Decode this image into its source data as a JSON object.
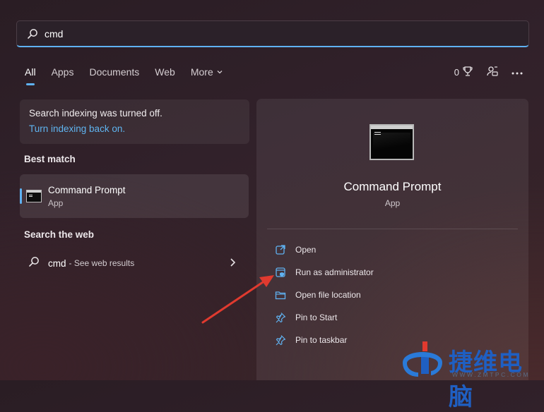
{
  "search": {
    "value": "cmd"
  },
  "tabs": [
    "All",
    "Apps",
    "Documents",
    "Web",
    "More"
  ],
  "toolbar": {
    "points": "0"
  },
  "indexing": {
    "message": "Search indexing was turned off.",
    "link": "Turn indexing back on."
  },
  "best_match": {
    "heading": "Best match",
    "item": {
      "title": "Command Prompt",
      "subtitle": "App"
    }
  },
  "web": {
    "heading": "Search the web",
    "query": "cmd",
    "hint": "- See web results"
  },
  "detail": {
    "title": "Command Prompt",
    "subtitle": "App",
    "actions": [
      {
        "label": "Open",
        "icon": "open-icon"
      },
      {
        "label": "Run as administrator",
        "icon": "shield-icon"
      },
      {
        "label": "Open file location",
        "icon": "folder-icon"
      },
      {
        "label": "Pin to Start",
        "icon": "pin-icon"
      },
      {
        "label": "Pin to taskbar",
        "icon": "pin-icon"
      }
    ]
  },
  "watermark": {
    "text": "捷维电脑",
    "sub": "WWW.ZMTPC.COM"
  },
  "colors": {
    "accent": "#5fb2f2",
    "link": "#5fb4f0",
    "arrow": "#e03a2f",
    "watermark": "#1f5fc2"
  }
}
